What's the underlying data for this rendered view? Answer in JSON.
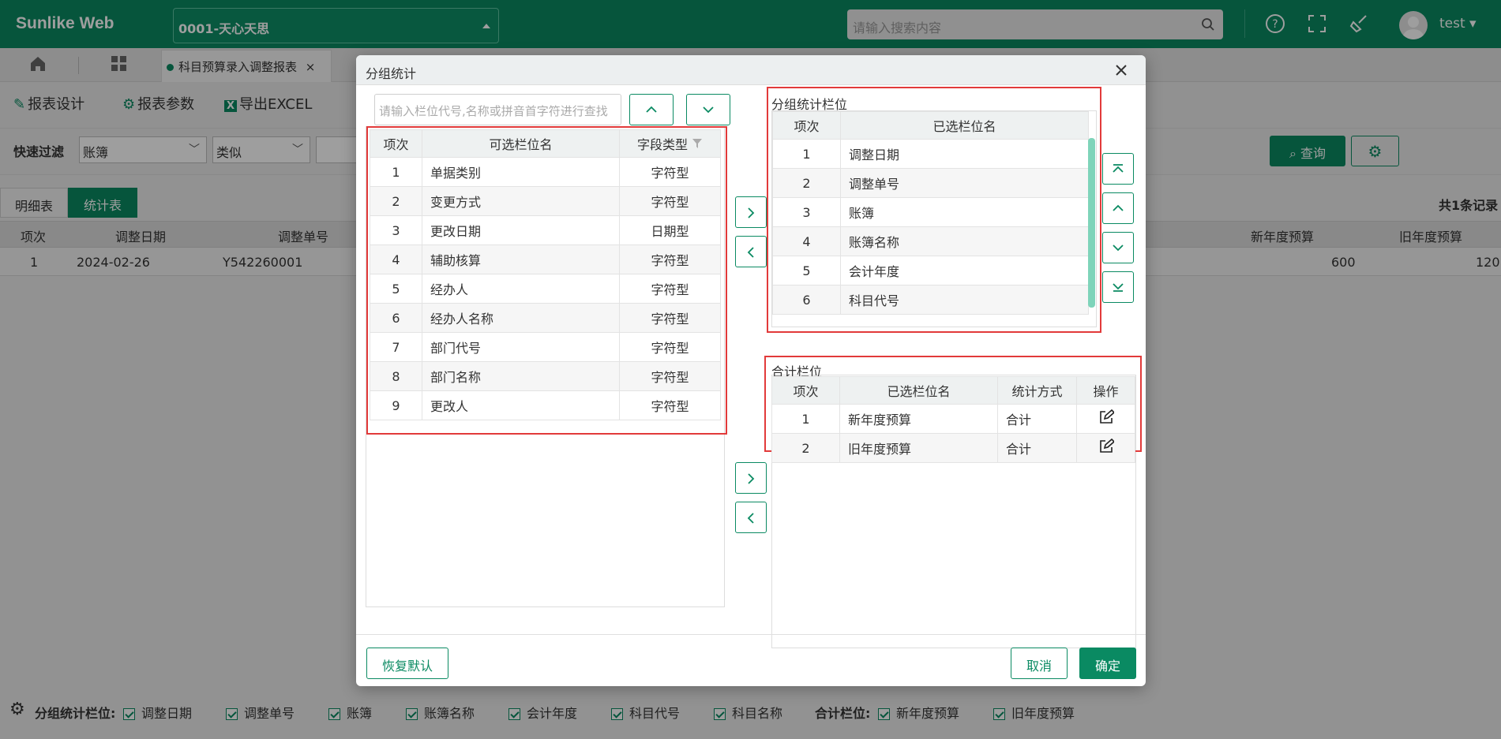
{
  "app": {
    "brand": "Sunlike Web",
    "company": "0001-天心天思",
    "search_placeholder": "请输入搜索内容",
    "user": "test"
  },
  "tabs": {
    "active_tab": "科目预算录入调整报表",
    "close": "×"
  },
  "toolbar": {
    "design": "报表设计",
    "params": "报表参数",
    "export": "导出EXCEL"
  },
  "filter": {
    "label": "快速过滤",
    "field": "账簿",
    "op": "类似",
    "query": "查询"
  },
  "subtabs": {
    "detail": "明细表",
    "stats": "统计表",
    "total": "共1条记录"
  },
  "grid": {
    "headers": [
      "项次",
      "调整日期",
      "调整单号",
      "新年度预算",
      "旧年度预算"
    ],
    "row": [
      "1",
      "2024-02-26",
      "Y542260001",
      "600",
      "120"
    ]
  },
  "bottom": {
    "group_label": "分组统计栏位:",
    "group_items": [
      "调整日期",
      "调整单号",
      "账簿",
      "账簿名称",
      "会计年度",
      "科目代号",
      "科目名称"
    ],
    "sum_label": "合计栏位:",
    "sum_items": [
      "新年度预算",
      "旧年度预算"
    ]
  },
  "dialog": {
    "title": "分组统计",
    "search_placeholder": "请输入栏位代号,名称或拼音首字符进行查找",
    "available": {
      "headers": [
        "项次",
        "可选栏位名",
        "字段类型"
      ],
      "rows": [
        [
          "1",
          "单据类别",
          "字符型"
        ],
        [
          "2",
          "变更方式",
          "字符型"
        ],
        [
          "3",
          "更改日期",
          "日期型"
        ],
        [
          "4",
          "辅助核算",
          "字符型"
        ],
        [
          "5",
          "经办人",
          "字符型"
        ],
        [
          "6",
          "经办人名称",
          "字符型"
        ],
        [
          "7",
          "部门代号",
          "字符型"
        ],
        [
          "8",
          "部门名称",
          "字符型"
        ],
        [
          "9",
          "更改人",
          "字符型"
        ]
      ]
    },
    "group": {
      "title": "分组统计栏位",
      "headers": [
        "项次",
        "已选栏位名"
      ],
      "rows": [
        [
          "1",
          "调整日期"
        ],
        [
          "2",
          "调整单号"
        ],
        [
          "3",
          "账簿"
        ],
        [
          "4",
          "账簿名称"
        ],
        [
          "5",
          "会计年度"
        ],
        [
          "6",
          "科目代号"
        ]
      ]
    },
    "sum": {
      "title": "合计栏位",
      "headers": [
        "项次",
        "已选栏位名",
        "统计方式",
        "操作"
      ],
      "rows": [
        [
          "1",
          "新年度预算",
          "合计"
        ],
        [
          "2",
          "旧年度预算",
          "合计"
        ]
      ]
    },
    "reset": "恢复默认",
    "cancel": "取消",
    "ok": "确定"
  },
  "colors": {
    "primary": "#0a8a62",
    "highlight": "#e23a3a"
  }
}
